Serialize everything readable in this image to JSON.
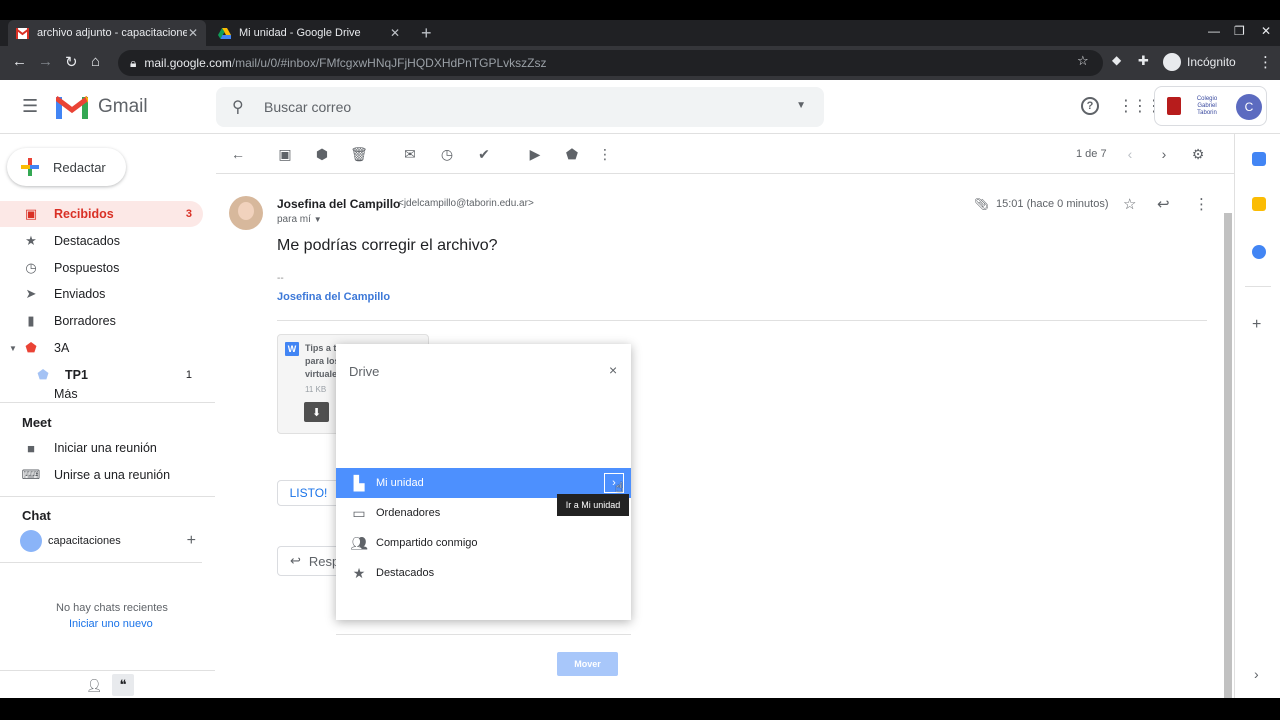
{
  "browser": {
    "tabs": [
      {
        "title": "archivo adjunto - capacitaciones@taborin.edu.ar",
        "close": "✕"
      },
      {
        "title": "Mi unidad - Google Drive",
        "close": "✕"
      }
    ],
    "new_tab": "+",
    "url_host": "mail.google.com",
    "url_path": "/mail/u/0/#inbox/FMfcgxwHNqJFjHQDXHdPnTGPLvkszZsz",
    "incognito_label": "Incógnito"
  },
  "gmail": {
    "logo_text": "Gmail",
    "search_placeholder": "Buscar correo",
    "account_badge": "Colegio Gabriel Taborin",
    "avatar_letter": "C",
    "compose_label": "Redactar",
    "nav": [
      {
        "label": "Recibidos",
        "count": "3"
      },
      {
        "label": "Destacados",
        "count": ""
      },
      {
        "label": "Pospuestos",
        "count": ""
      },
      {
        "label": "Enviados",
        "count": ""
      },
      {
        "label": "Borradores",
        "count": ""
      },
      {
        "label": "3A",
        "count": ""
      },
      {
        "label": "TP1",
        "count": "1"
      },
      {
        "label": "Más",
        "count": ""
      }
    ],
    "meet": {
      "heading": "Meet",
      "items": [
        "Iniciar una reunión",
        "Unirse a una reunión"
      ]
    },
    "chat": {
      "heading": "Chat",
      "user": "capacitaciones",
      "add": "+",
      "empty_text": "No hay chats recientes",
      "start_link": "Iniciar uno nuevo"
    },
    "pagination": "1 de 7",
    "message": {
      "sender_name": "Josefina del Campillo",
      "sender_email": "<jdelcampillo@taborin.edu.ar>",
      "to": "para mí",
      "time": "15:01 (hace 0 minutos)",
      "subject": "Me podrías corregir el archivo?",
      "sig_dash": "--",
      "signature": "Josefina del Campillo",
      "attachment": {
        "name": "Tips a tener en cuenta para los encuentros virtuales.docx",
        "name_l1": "Tips a tener en cuenta",
        "name_l2": "para los encuentros",
        "name_l3": "virtuales.docx",
        "size": "11 KB",
        "badge": "W"
      },
      "listo_label": "LISTO!",
      "reply_label": "Resp"
    }
  },
  "drive_dialog": {
    "title": "Drive",
    "close": "×",
    "items": [
      {
        "label": "Mi unidad",
        "icon": "drive-icon"
      },
      {
        "label": "Ordenadores",
        "icon": "computers-icon"
      },
      {
        "label": "Compartido conmigo",
        "icon": "people-icon"
      },
      {
        "label": "Destacados",
        "icon": "star-icon"
      }
    ],
    "tooltip": "Ir a Mi unidad",
    "move_button": "Mover"
  },
  "colors": {
    "gmail_red": "#d93025",
    "selected_blue": "#4d90fe",
    "link_blue": "#1a73e8"
  }
}
